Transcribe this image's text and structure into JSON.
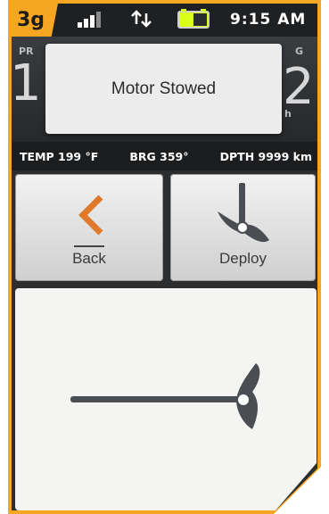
{
  "status_bar": {
    "network_badge": "3g",
    "signal_icon": "signal-strength-icon",
    "data_icon": "data-arrows-icon",
    "battery_icon": "battery-icon",
    "time": "9:15 AM"
  },
  "notification": {
    "message": "Motor Stowed"
  },
  "data_strip": {
    "temp": "TEMP 199 °F",
    "bearing": "BRG 359°",
    "depth": "DPTH 9999 km"
  },
  "buttons": {
    "back_label": "Back",
    "deploy_label": "Deploy"
  },
  "colors": {
    "accent": "#f6a623",
    "back_arrow": "#e07a2a",
    "motor_icon": "#4a4d51"
  }
}
